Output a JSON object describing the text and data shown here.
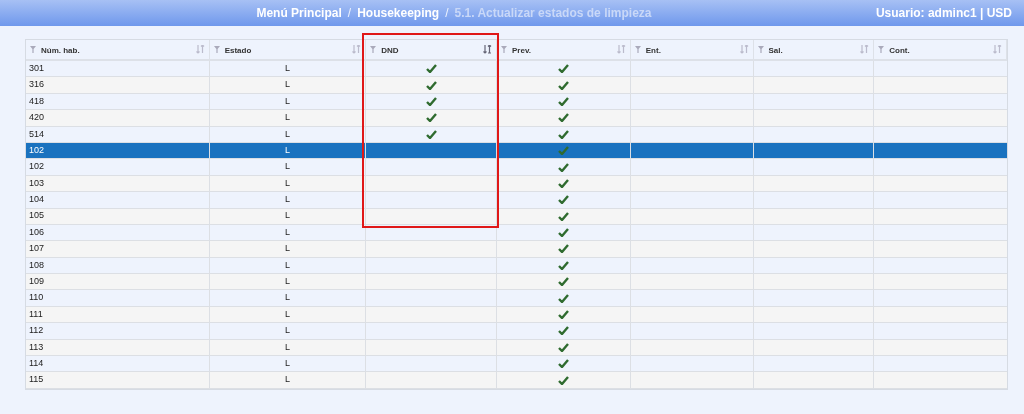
{
  "header": {
    "breadcrumbs": [
      {
        "label": "Menú Principal",
        "current": false
      },
      {
        "label": "Housekeeping",
        "current": false
      },
      {
        "label": "5.1. Actualizar estados de limpieza",
        "current": true
      }
    ],
    "separator": "/",
    "user": "Usuario: adminc1 | USD"
  },
  "table": {
    "columns": [
      {
        "label": "Núm. hab.",
        "sorted": false,
        "highlighted": false
      },
      {
        "label": "Estado",
        "sorted": false,
        "highlighted": false
      },
      {
        "label": "DND",
        "sorted": true,
        "highlighted": true
      },
      {
        "label": "Prev.",
        "sorted": false,
        "highlighted": false
      },
      {
        "label": "Ent.",
        "sorted": false,
        "highlighted": false
      },
      {
        "label": "Sal.",
        "sorted": false,
        "highlighted": false
      },
      {
        "label": "Cont.",
        "sorted": false,
        "highlighted": false
      }
    ],
    "rows": [
      {
        "room": "301",
        "status": "L",
        "dnd": true,
        "prev": true,
        "selected": false
      },
      {
        "room": "316",
        "status": "L",
        "dnd": true,
        "prev": true,
        "selected": false
      },
      {
        "room": "418",
        "status": "L",
        "dnd": true,
        "prev": true,
        "selected": false
      },
      {
        "room": "420",
        "status": "L",
        "dnd": true,
        "prev": true,
        "selected": false
      },
      {
        "room": "514",
        "status": "L",
        "dnd": true,
        "prev": true,
        "selected": false
      },
      {
        "room": "102",
        "status": "L",
        "dnd": false,
        "prev": true,
        "selected": true
      },
      {
        "room": "102",
        "status": "L",
        "dnd": false,
        "prev": true,
        "selected": false
      },
      {
        "room": "103",
        "status": "L",
        "dnd": false,
        "prev": true,
        "selected": false
      },
      {
        "room": "104",
        "status": "L",
        "dnd": false,
        "prev": true,
        "selected": false
      },
      {
        "room": "105",
        "status": "L",
        "dnd": false,
        "prev": true,
        "selected": false
      },
      {
        "room": "106",
        "status": "L",
        "dnd": false,
        "prev": true,
        "selected": false
      },
      {
        "room": "107",
        "status": "L",
        "dnd": false,
        "prev": true,
        "selected": false
      },
      {
        "room": "108",
        "status": "L",
        "dnd": false,
        "prev": true,
        "selected": false
      },
      {
        "room": "109",
        "status": "L",
        "dnd": false,
        "prev": true,
        "selected": false
      },
      {
        "room": "110",
        "status": "L",
        "dnd": false,
        "prev": true,
        "selected": false
      },
      {
        "room": "111",
        "status": "L",
        "dnd": false,
        "prev": true,
        "selected": false
      },
      {
        "room": "112",
        "status": "L",
        "dnd": false,
        "prev": true,
        "selected": false
      },
      {
        "room": "113",
        "status": "L",
        "dnd": false,
        "prev": true,
        "selected": false
      },
      {
        "room": "114",
        "status": "L",
        "dnd": false,
        "prev": true,
        "selected": false
      },
      {
        "room": "115",
        "status": "L",
        "dnd": false,
        "prev": true,
        "selected": false
      }
    ]
  }
}
